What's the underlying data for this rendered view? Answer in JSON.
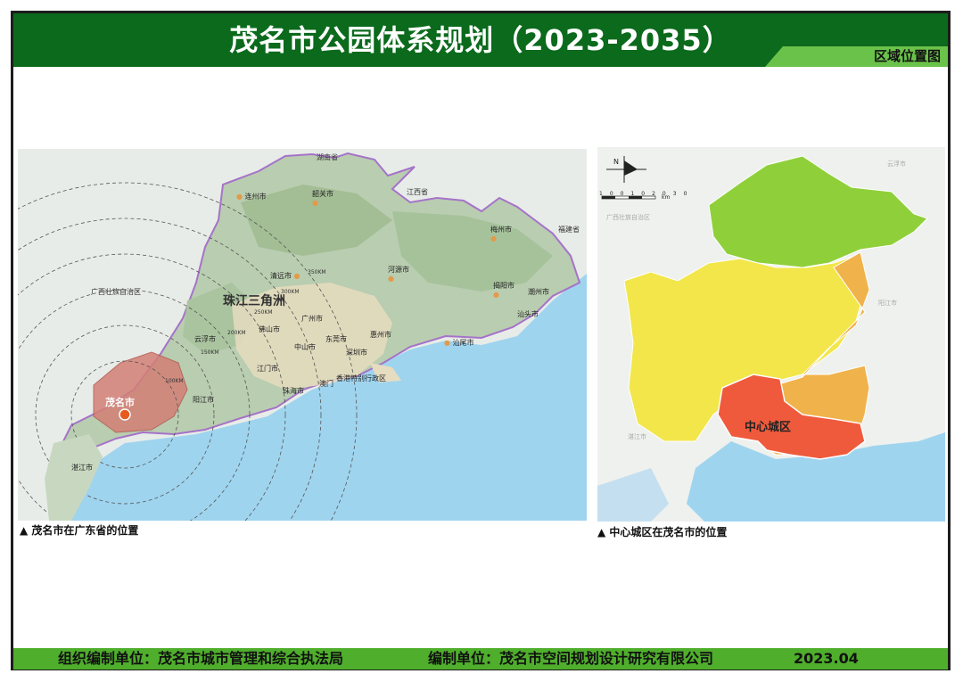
{
  "title": "茂名市公园体系规划（2023-2035）",
  "sheet_tag": "区域位置图",
  "left_map": {
    "caption": "▲ 茂名市在广东省的位置",
    "provinces": [
      "湖南省",
      "江西省",
      "福建省",
      "广西壮族自治区"
    ],
    "region_label": "珠江三角洲",
    "highlight_label": "茂名市",
    "cities": [
      "连州市",
      "韶关市",
      "梅州市",
      "清远市",
      "河源市",
      "揭阳市",
      "潮州市",
      "汕头市",
      "云浮市",
      "佛山市",
      "广州市",
      "东莞市",
      "惠州市",
      "汕尾市",
      "中山市",
      "深圳市",
      "江门市",
      "阳江市",
      "珠海市",
      "澳门",
      "香港特别行政区",
      "湛江市"
    ],
    "rings": [
      "100KM",
      "150KM",
      "200KM",
      "250KM",
      "300KM",
      "350KM"
    ]
  },
  "right_map": {
    "caption": "▲ 中心城区在茂名市的位置",
    "center_label": "中心城区",
    "scale_ticks": [
      "10",
      "0",
      "10",
      "20",
      "30"
    ],
    "scale_unit": "km",
    "neighbors": [
      "广西壮族自治区",
      "阳江市",
      "湛江市",
      "云浮市"
    ],
    "north_label": "N",
    "colors": {
      "north": "#8fd03a",
      "west": "#f2e64a",
      "east": "#f0b24a",
      "center": "#f05a3c"
    }
  },
  "footer": {
    "org": "组织编制单位：茂名市城市管理和综合执法局",
    "compiler": "编制单位：茂名市空间规划设计研究有限公司",
    "date": "2023.04"
  },
  "colors": {
    "title_bar": "#0b6a1c",
    "footer_bar": "#4fae2c",
    "sea": "#9fd4ef",
    "province_border": "#a573c9"
  }
}
